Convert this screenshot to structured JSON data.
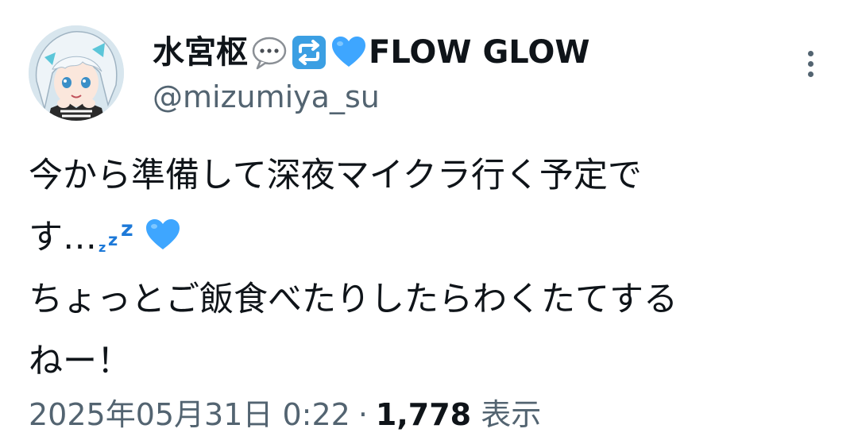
{
  "author": {
    "display_name": "水宮枢",
    "name_emojis": [
      "speech-bubble-icon",
      "repeat-icon",
      "blue-heart-icon"
    ],
    "name_suffix": "FLOW GLOW",
    "handle": "@mizumiya_su"
  },
  "tweet": {
    "lines": [
      "今から準備して深夜マイクラ行く予定で",
      "す…",
      "ちょっとご飯食べたりしたらわくたてする",
      "ねー！"
    ],
    "line2_emojis": [
      "zzz-icon",
      "blue-heart-icon"
    ]
  },
  "meta": {
    "timestamp": "2025年05月31日 0:22",
    "separator": "·",
    "views_count": "1,778",
    "views_label": "表示"
  },
  "colors": {
    "text_primary": "#0f1419",
    "text_secondary": "#536471",
    "emoji_blue": "#1d9bf0",
    "heart_blue": "#3ea6ff"
  }
}
